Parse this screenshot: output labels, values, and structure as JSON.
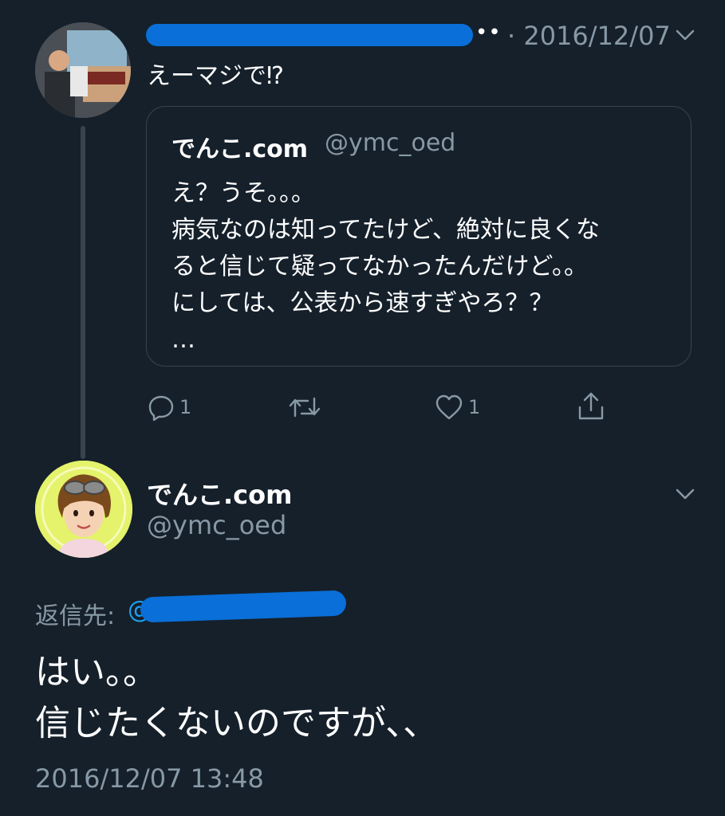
{
  "parent_tweet": {
    "date": "· 2016/12/07",
    "more_glyph": "••",
    "text": "えーマジで⁉︎",
    "quoted": {
      "name": "でんこ.com",
      "handle": "@ymc_oed",
      "text": "え？うそ。。。\n病気なのは知ってたけど、絶対に良くな\nると信じて疑ってなかったんだけど。。\nにしては、公表から速すぎやろ？？\n…"
    },
    "actions": {
      "reply_count": "1",
      "retweet_count": "",
      "like_count": "1"
    }
  },
  "main_tweet": {
    "name": "でんこ.com",
    "handle": "@ymc_oed",
    "reply_label": "返信先:",
    "reply_at": "@",
    "text": "はい。。\n信じたくないのですが、、",
    "timestamp": "2016/12/07 13:48"
  },
  "colors": {
    "background": "#15202b",
    "muted": "#8899a6",
    "accent": "#1da1f2",
    "border": "#38444d",
    "redaction": "#0a6fd8"
  }
}
